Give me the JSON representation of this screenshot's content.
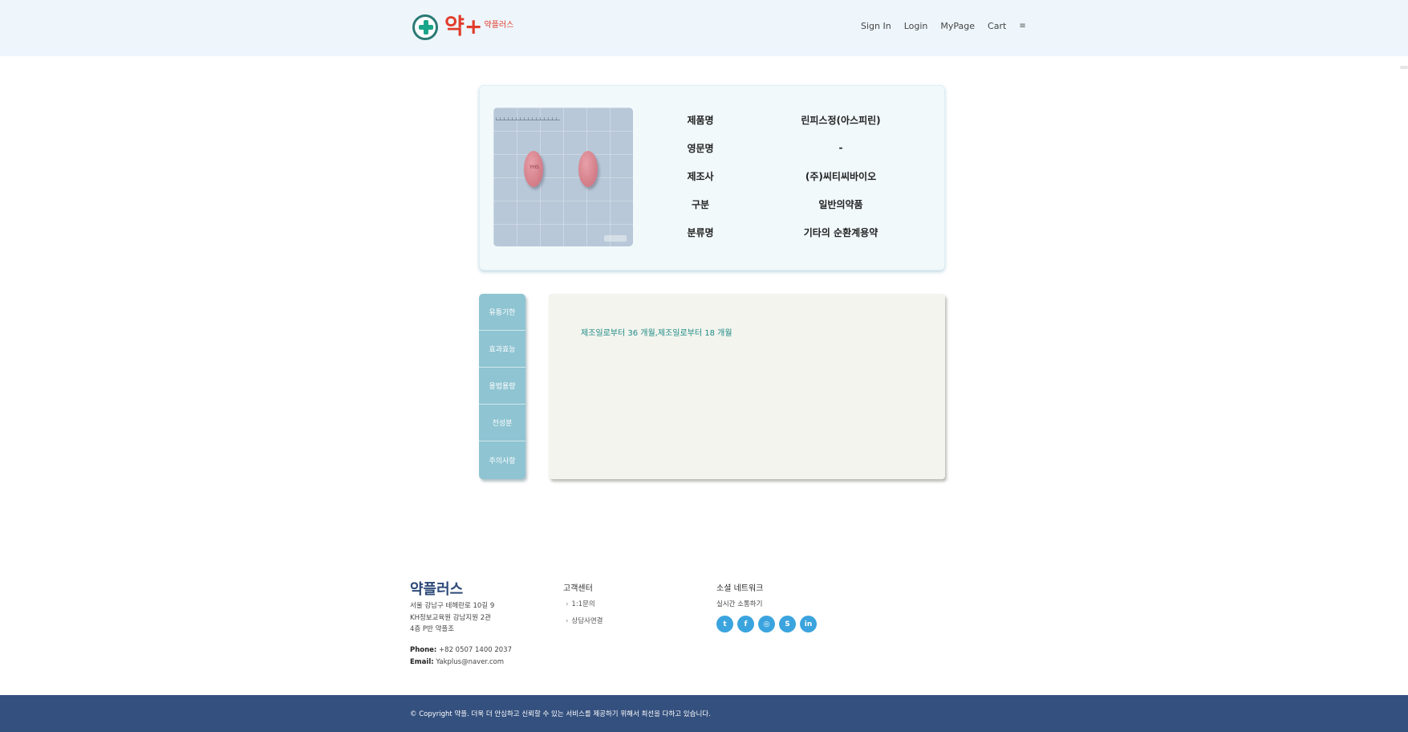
{
  "header": {
    "logo_main": "약+",
    "logo_sub": "약플러스",
    "nav": {
      "sign_in": "Sign In",
      "login": "Login",
      "mypage": "MyPage",
      "cart": "Cart",
      "menu_icon": "≡"
    }
  },
  "product": {
    "image_icon": "pill-image",
    "pill_imprint": "YHS",
    "fields": [
      {
        "label": "제품명",
        "value": "린피스정(아스피린)"
      },
      {
        "label": "영문명",
        "value": "-"
      },
      {
        "label": "제조사",
        "value": "(주)씨티씨바이오"
      },
      {
        "label": "구분",
        "value": "일반의약품"
      },
      {
        "label": "분류명",
        "value": "기타의 순환계용약"
      }
    ]
  },
  "tabs": [
    "유통기한",
    "효과효능",
    "용법용량",
    "전성분",
    "주의사항"
  ],
  "content": {
    "text": "제조일로부터 36 개월,제조일로부터 18 개월"
  },
  "footer": {
    "brand": "약플러스",
    "address": [
      "서울 강남구 테헤란로 10길 9",
      "KH정보교육원 강남지원 2관",
      "4층 P반 약플조"
    ],
    "phone_label": "Phone:",
    "phone": "+82 0507 1400 2037",
    "email_label": "Email:",
    "email": "Yakplus@naver.com",
    "support": {
      "heading": "고객센터",
      "links": [
        "1:1문의",
        "상담사연결"
      ]
    },
    "social": {
      "heading": "소셜 네트워크",
      "note": "실시간 소통하기",
      "icons": [
        {
          "name": "twitter-icon",
          "glyph": "t"
        },
        {
          "name": "facebook-icon",
          "glyph": "f"
        },
        {
          "name": "instagram-icon",
          "glyph": "◎"
        },
        {
          "name": "skype-icon",
          "glyph": "S"
        },
        {
          "name": "linkedin-icon",
          "glyph": "in"
        }
      ],
      "color": "#3ba4de"
    },
    "copyright": "© Copyright 약플. 더욱 더 안심하고 신뢰할 수 있는 서비스를 제공하기 위해서 최선을 다하고 있습니다."
  },
  "colors": {
    "header_bg": "#eef6fc",
    "logo": "#e13b2a",
    "tab_bg": "#8fc4d2",
    "content_text": "#1f8a86",
    "copyright_bg": "#34507e"
  }
}
